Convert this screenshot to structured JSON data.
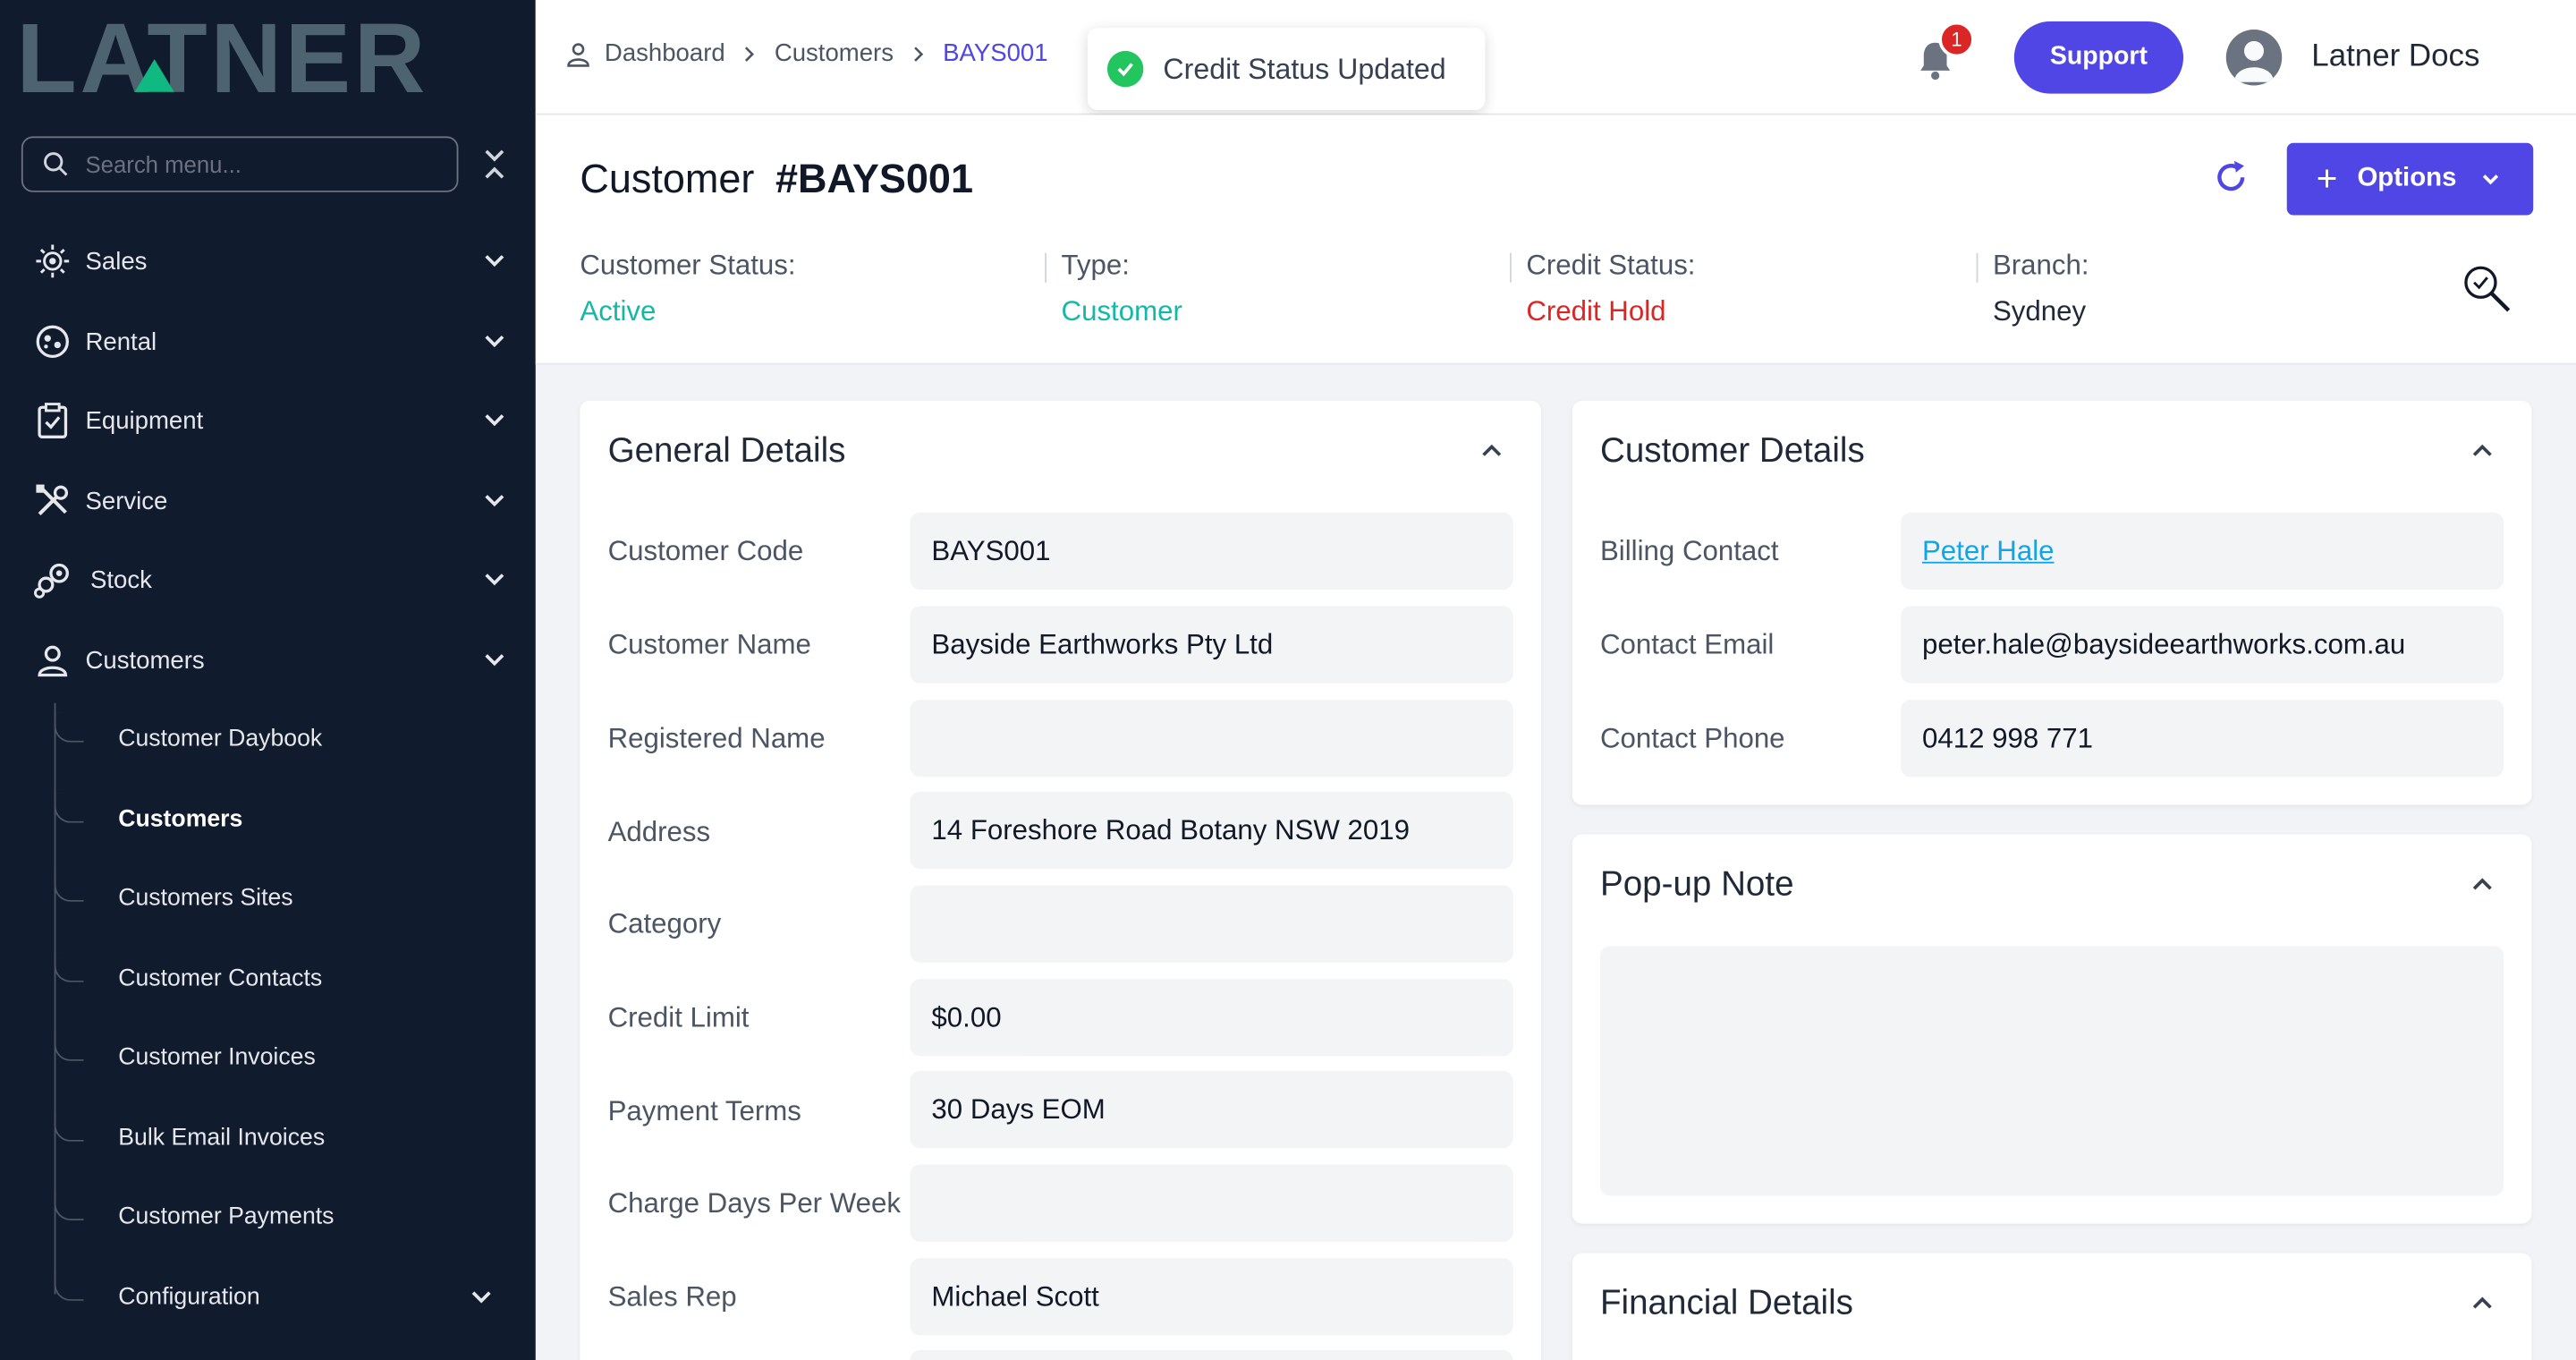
{
  "sidebar": {
    "logo_text": "LATNER",
    "search_placeholder": "Search menu...",
    "items": [
      {
        "label": "Sales"
      },
      {
        "label": "Rental"
      },
      {
        "label": "Equipment"
      },
      {
        "label": "Service"
      },
      {
        "label": "Stock"
      },
      {
        "label": "Customers"
      }
    ],
    "sub_items": [
      {
        "label": "Customer Daybook"
      },
      {
        "label": "Customers"
      },
      {
        "label": "Customers Sites"
      },
      {
        "label": "Customer Contacts"
      },
      {
        "label": "Customer Invoices"
      },
      {
        "label": "Bulk Email Invoices"
      },
      {
        "label": "Customer Payments"
      },
      {
        "label": "Configuration"
      }
    ]
  },
  "topbar": {
    "breadcrumb": [
      "Dashboard",
      "Customers",
      "BAYS001"
    ],
    "toast": "Credit Status Updated",
    "notification_count": "1",
    "support_label": "Support",
    "user_name": "Latner Docs"
  },
  "customer": {
    "title_prefix": "Customer",
    "code": "#BAYS001",
    "options_label": "Options",
    "stats": [
      {
        "key": "Customer Status:",
        "value": "Active",
        "color": "#14b8a6"
      },
      {
        "key": "Type:",
        "value": "Customer",
        "color": "#14b8a6"
      },
      {
        "key": "Credit Status:",
        "value": "Credit Hold",
        "color": "#dc2626"
      },
      {
        "key": "Branch:",
        "value": "Sydney",
        "color": "#1f2937"
      }
    ]
  },
  "general": {
    "title": "General Details",
    "rows": [
      {
        "label": "Customer Code",
        "value": "BAYS001"
      },
      {
        "label": "Customer Name",
        "value": "Bayside Earthworks Pty Ltd"
      },
      {
        "label": "Registered Name",
        "value": ""
      },
      {
        "label": "Address",
        "value": "14 Foreshore Road Botany NSW 2019"
      },
      {
        "label": "Category",
        "value": ""
      },
      {
        "label": "Credit Limit",
        "value": "$0.00"
      },
      {
        "label": "Payment Terms",
        "value": "30 Days EOM"
      },
      {
        "label": "Charge Days Per Week",
        "value": ""
      },
      {
        "label": "Sales Rep",
        "value": "Michael Scott"
      }
    ]
  },
  "customer_details": {
    "title": "Customer Details",
    "rows": [
      {
        "label": "Billing Contact",
        "value": "Peter Hale"
      },
      {
        "label": "Contact Email",
        "value": "peter.hale@baysideearthworks.com.au"
      },
      {
        "label": "Contact Phone",
        "value": "0412 998 771"
      }
    ]
  },
  "popup_note": {
    "title": "Pop-up Note"
  },
  "financial": {
    "title": "Financial Details"
  }
}
